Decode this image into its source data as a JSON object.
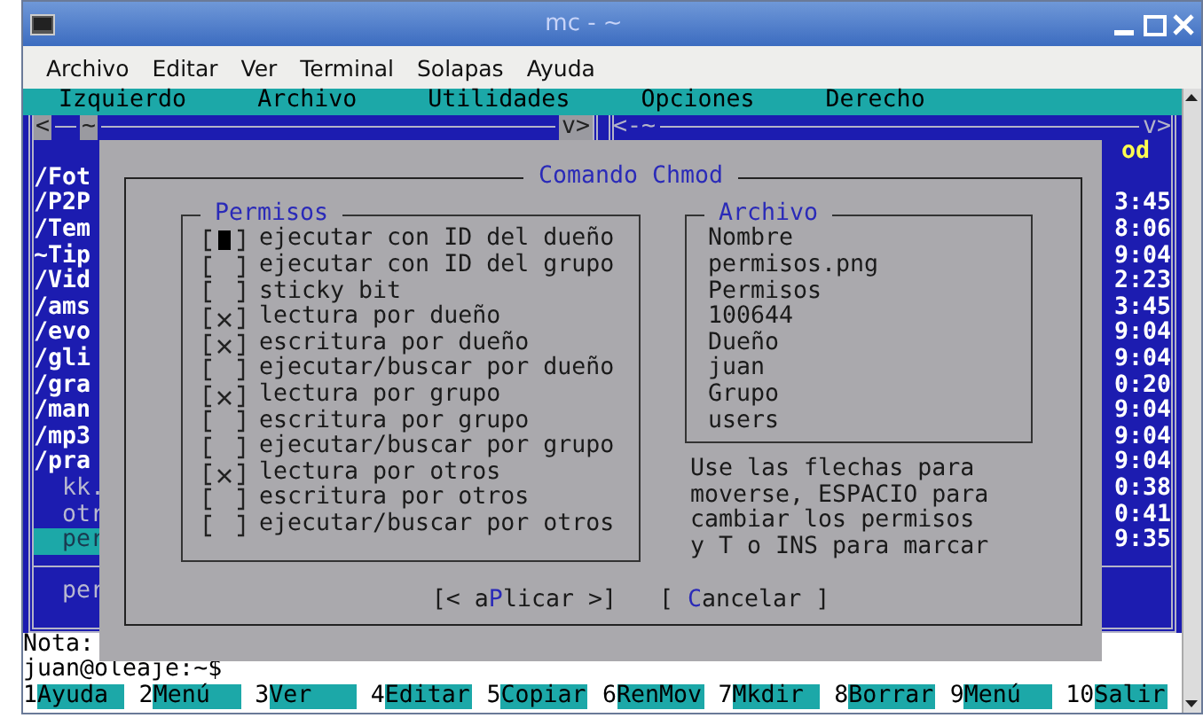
{
  "window": {
    "title": "mc - ~"
  },
  "menu_bar": [
    "Archivo",
    "Editar",
    "Ver",
    "Terminal",
    "Solapas",
    "Ayuda"
  ],
  "terminal": {
    "mc_menu": [
      "Izquierdo",
      "Archivo",
      "Utilidades",
      "Opciones",
      "Derecho"
    ],
    "left_panel": {
      "nav": [
        "<",
        "~"
      ],
      "toggle": "v>",
      "files": [
        {
          "name": "/Fot",
          "kind": "dir",
          "selected": false
        },
        {
          "name": "/P2P",
          "kind": "dir",
          "selected": false
        },
        {
          "name": "/Tem",
          "kind": "dir",
          "selected": false
        },
        {
          "name": "~Tip",
          "kind": "dir",
          "selected": false
        },
        {
          "name": "/Vid",
          "kind": "dir",
          "selected": false
        },
        {
          "name": "/ams",
          "kind": "dir",
          "selected": false
        },
        {
          "name": "/evo",
          "kind": "dir",
          "selected": false
        },
        {
          "name": "/gli",
          "kind": "dir",
          "selected": false
        },
        {
          "name": "/gra",
          "kind": "dir",
          "selected": false
        },
        {
          "name": "/man",
          "kind": "dir",
          "selected": false
        },
        {
          "name": "/mp3",
          "kind": "dir",
          "selected": false
        },
        {
          "name": "/pra",
          "kind": "dir",
          "selected": false
        },
        {
          "name": "kk.",
          "kind": "file",
          "selected": false
        },
        {
          "name": "otr",
          "kind": "file",
          "selected": false
        },
        {
          "name": "per",
          "kind": "file",
          "selected": true
        }
      ],
      "mini_status": "per"
    },
    "right_panel": {
      "nav": "<-~",
      "toggle": "v>",
      "header": "od",
      "times": [
        "3:45",
        "8:06",
        "9:04",
        "2:23",
        "3:45",
        "9:04",
        "9:04",
        "0:20",
        "9:04",
        "9:04",
        "9:04",
        "0:38",
        "0:41",
        "9:35"
      ]
    },
    "note": "Nota:",
    "prompt": "juan@oleaje:~$",
    "function_keys": [
      {
        "number": "1",
        "label": "Ayuda"
      },
      {
        "number": "2",
        "label": "Menú"
      },
      {
        "number": "3",
        "label": "Ver"
      },
      {
        "number": "4",
        "label": "Editar"
      },
      {
        "number": "5",
        "label": "Copiar"
      },
      {
        "number": "6",
        "label": "RenMov"
      },
      {
        "number": "7",
        "label": "Mkdir"
      },
      {
        "number": "8",
        "label": "Borrar"
      },
      {
        "number": "9",
        "label": "Menú"
      },
      {
        "number": "10",
        "label": "Salir"
      }
    ]
  },
  "dialog": {
    "title": "Comando Chmod",
    "permissions": {
      "title": "Permisos",
      "items": [
        {
          "label": "ejecutar con ID del dueño",
          "checked": false,
          "focused": true
        },
        {
          "label": "ejecutar con ID del grupo",
          "checked": false,
          "focused": false
        },
        {
          "label": "sticky bit",
          "checked": false,
          "focused": false
        },
        {
          "label": "lectura por dueño",
          "checked": true,
          "focused": false
        },
        {
          "label": "escritura por dueño",
          "checked": true,
          "focused": false
        },
        {
          "label": "ejecutar/buscar por dueño",
          "checked": false,
          "focused": false
        },
        {
          "label": "lectura por grupo",
          "checked": true,
          "focused": false
        },
        {
          "label": "escritura por grupo",
          "checked": false,
          "focused": false
        },
        {
          "label": "ejecutar/buscar por grupo",
          "checked": false,
          "focused": false
        },
        {
          "label": "lectura por otros",
          "checked": true,
          "focused": false
        },
        {
          "label": "escritura por otros",
          "checked": false,
          "focused": false
        },
        {
          "label": "ejecutar/buscar por otros",
          "checked": false,
          "focused": false
        }
      ]
    },
    "file_info": {
      "title": "Archivo",
      "lines": [
        "Nombre",
        "permisos.png",
        "Permisos",
        "100644",
        "Dueño",
        "juan",
        "Grupo",
        "users"
      ]
    },
    "help": [
      "Use las flechas para",
      "moverse, ESPACIO para",
      "cambiar los permisos",
      "y T o INS para marcar"
    ],
    "buttons": [
      {
        "before": "[< a",
        "hotkey": "P",
        "after": "licar >]"
      },
      {
        "before": "[ ",
        "hotkey": "C",
        "after": "ancelar ]"
      }
    ]
  }
}
